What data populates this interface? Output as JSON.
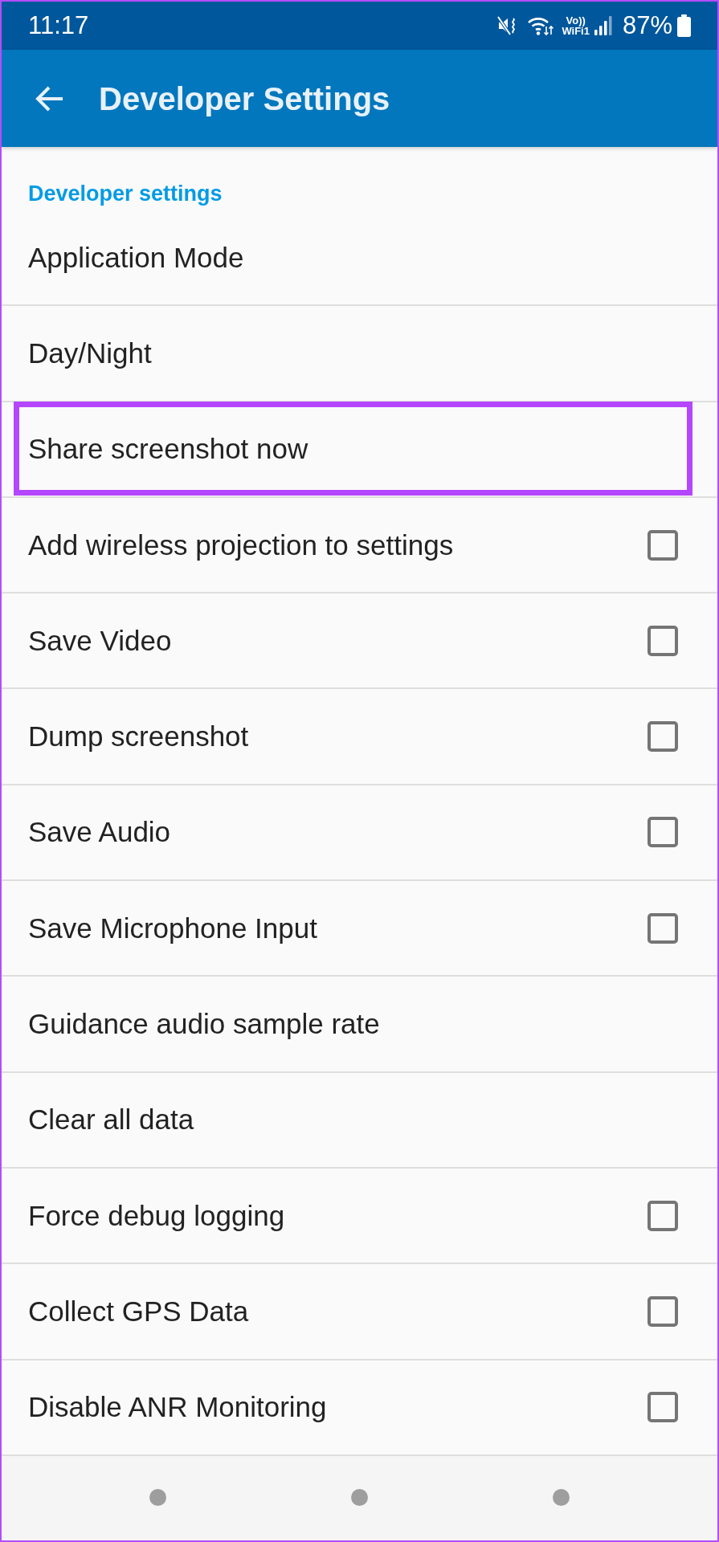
{
  "status_bar": {
    "time": "11:17",
    "vowifi": [
      "Vo))",
      "WiFi1"
    ],
    "battery": "87%"
  },
  "app_bar": {
    "title": "Developer Settings"
  },
  "section": {
    "header": "Developer settings"
  },
  "settings": [
    {
      "label": "Application Mode",
      "kind": "plain",
      "highlighted": false
    },
    {
      "label": "Day/Night",
      "kind": "plain",
      "highlighted": false
    },
    {
      "label": "Share screenshot now",
      "kind": "plain",
      "highlighted": true
    },
    {
      "label": "Add wireless projection to settings",
      "kind": "checkbox",
      "checked": false,
      "highlighted": false
    },
    {
      "label": "Save Video",
      "kind": "checkbox",
      "checked": false,
      "highlighted": false
    },
    {
      "label": "Dump screenshot",
      "kind": "checkbox",
      "checked": false,
      "highlighted": false
    },
    {
      "label": "Save Audio",
      "kind": "checkbox",
      "checked": false,
      "highlighted": false
    },
    {
      "label": "Save Microphone Input",
      "kind": "checkbox",
      "checked": false,
      "highlighted": false
    },
    {
      "label": "Guidance audio sample rate",
      "kind": "plain",
      "highlighted": false
    },
    {
      "label": "Clear all data",
      "kind": "plain",
      "highlighted": false
    },
    {
      "label": "Force debug logging",
      "kind": "checkbox",
      "checked": false,
      "highlighted": false
    },
    {
      "label": "Collect GPS Data",
      "kind": "checkbox",
      "checked": false,
      "highlighted": false
    },
    {
      "label": "Disable ANR Monitoring",
      "kind": "checkbox",
      "checked": false,
      "highlighted": false
    }
  ]
}
